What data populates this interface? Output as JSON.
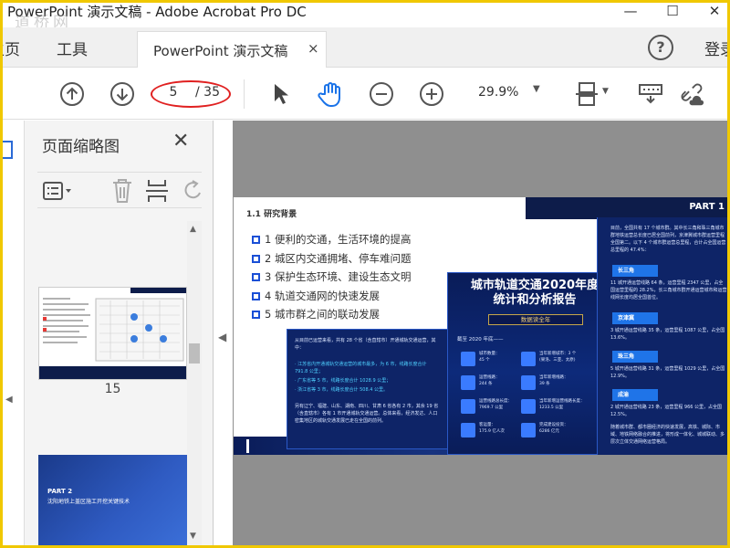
{
  "window": {
    "title": "PowerPoint 演示文稿 - Adobe Acrobat Pro DC",
    "watermark": "道桥网",
    "controls": {
      "minimize": "—",
      "maximize": "☐",
      "close": "✕"
    }
  },
  "menu": {
    "home": "主页",
    "tools": "工具",
    "doc_tab": {
      "label": "PowerPoint 演示文稿",
      "close": "×"
    },
    "help": "?",
    "login": "登录"
  },
  "toolbar": {
    "page_current": "5",
    "page_total": "/ 35",
    "zoom": "29.9%",
    "icons": [
      "page-up-icon",
      "page-down-icon",
      "select-pointer-icon",
      "hand-tool-icon",
      "zoom-out-icon",
      "zoom-in-icon",
      "page-display-icon",
      "keyboard-icon",
      "share-link-icon"
    ],
    "accent": "#1a73e8",
    "highlight_color": "#e02020"
  },
  "sidebar": {
    "title": "页面缩略图",
    "close": "✕",
    "thumbnails": [
      {
        "page": "15"
      },
      {
        "part": "PART 2",
        "text": "沈阳地铁上盖区施工开挖关键技术"
      }
    ]
  },
  "document": {
    "heading": "1.1 研究背景",
    "part_label": "PART 1",
    "list": [
      "1 便利的交通，生活环境的提高",
      "2 城区内交通拥堵、停车难问题",
      "3 保护生态环境、建设生态文明",
      "4 轨道交通网的快速发展",
      "5 城市群之间的联动发展"
    ],
    "left_card": {
      "intro": "从目前已运营来看，共有 28 个省（含直辖市）开通城轨交通运营，其中：",
      "lines": [
        "· 江苏省内开通城轨交通运营的城市最多，为 6 市，线路长度合计 791.8 公里；",
        "· 广东省等 5 市，线路长度合计 1028.9 公里；",
        "· 浙江省等 3 市，线路长度合计 508.4 公里。"
      ],
      "outro": "另有辽宁、福建、山东、湖南、四川、甘肃 6 省各有 2 市，其余 19 省（含直辖市）各有 1 市开通城轨交通运营。总体来看，经济发达、人口密集地区的城轨交通发展已走在全国的前列。"
    },
    "center_card": {
      "title_line1": "城市轨道交通2020年度",
      "title_line2": "统计和分析报告",
      "badge": "数据读全年",
      "subtitle": "截至 2020 年底——",
      "stats": [
        {
          "label": "城市数量：",
          "value": "45 个"
        },
        {
          "label": "当年新增城市：3 个",
          "value": "(果洛、三亚、太原)"
        },
        {
          "label": "运营线路：",
          "value": "244 条"
        },
        {
          "label": "当年新增线路：",
          "value": "39 条"
        },
        {
          "label": "运营线路总长度：",
          "value": "7969.7 公里"
        },
        {
          "label": "当年新增运营线路长度：",
          "value": "1233.5 公里"
        },
        {
          "label": "客运量：",
          "value": "175.9 亿人次"
        },
        {
          "label": "完成建设投资：",
          "value": "6286 亿元"
        }
      ]
    },
    "right_card": {
      "intro": "目前，全国共有 17 个城市群。其中长三角和珠三角城市群地铁运营总长度已居全国前列，京津冀城市群运营里程全国第二。以下 4 个城市群运营总里程，合计占全国运营总里程的 47.4%：",
      "regions": [
        {
          "tag": "长三角",
          "text": "11 城开通运营线路 64 条，运营里程 2347 公里，占全国运营里程的 28.2%，长三角城市群开通运营城市和运营线网长度均居全国首位。"
        },
        {
          "tag": "京津冀",
          "text": "3 城开通运营线路 35 条，运营里程 1087 公里，占全国 13.6%。"
        },
        {
          "tag": "珠三角",
          "text": "5 城开通运营线路 31 条，运营里程 1029 公里，占全国 12.9%。"
        },
        {
          "tag": "成渝",
          "text": "2 城开通运营线路 23 条，运营里程 966 公里，占全国 12.5%。"
        }
      ],
      "outro": "随着城市群、都市圈经济的快速发展，高铁、城际、市域、地铁网络融合的推进，将形成一体化、城城联动、多层次立体交通网络运营格局。"
    }
  }
}
